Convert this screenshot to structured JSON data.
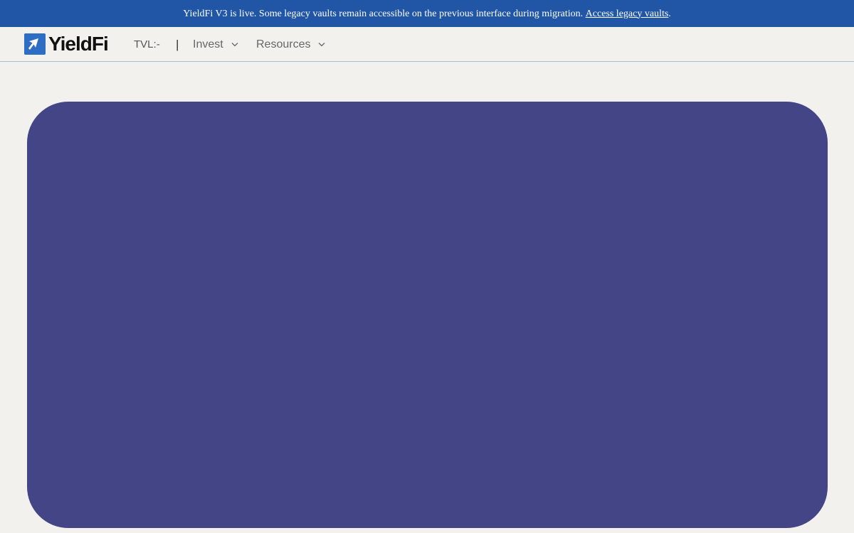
{
  "banner": {
    "message": "YieldFi V3 is live. Some legacy vaults remain accessible on the previous interface during migration. ",
    "link_label": "Access legacy vaults",
    "suffix": "."
  },
  "nav": {
    "logo_text": "YieldFi",
    "tvl_label": "TVL:",
    "tvl_value": "-",
    "separator": "|",
    "menus": [
      {
        "label": "Invest",
        "icon": "chevron-down-icon"
      },
      {
        "label": "Resources",
        "icon": "chevron-down-icon"
      }
    ]
  },
  "colors": {
    "banner_bg": "#2056a5",
    "page_bg": "#f2f1ed",
    "logo_mark": "#2d6ec4",
    "hero_bg": "#434587"
  }
}
